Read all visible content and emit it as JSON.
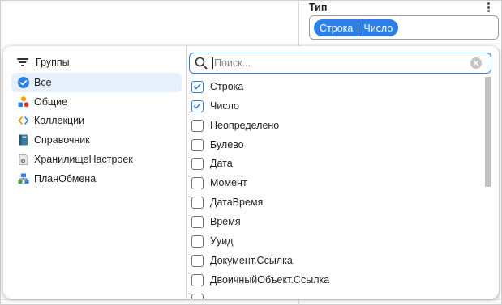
{
  "type_section": {
    "title": "Тип",
    "selected_chips": [
      "Строка",
      "Число"
    ]
  },
  "groups": {
    "header": "Группы",
    "items": [
      {
        "label": "Все",
        "icon": "check-circle-icon",
        "selected": true
      },
      {
        "label": "Общие",
        "icon": "shapes-icon",
        "selected": false
      },
      {
        "label": "Коллекции",
        "icon": "code-brackets-icon",
        "selected": false
      },
      {
        "label": "Справочник",
        "icon": "book-icon",
        "selected": false
      },
      {
        "label": "ХранилищеНастроек",
        "icon": "settings-storage-icon",
        "selected": false
      },
      {
        "label": "ПланОбмена",
        "icon": "exchange-plan-icon",
        "selected": false
      }
    ]
  },
  "search": {
    "placeholder": "Поиск...",
    "value": ""
  },
  "types": [
    {
      "label": "Строка",
      "checked": true
    },
    {
      "label": "Число",
      "checked": true
    },
    {
      "label": "Неопределено",
      "checked": false
    },
    {
      "label": "Булево",
      "checked": false
    },
    {
      "label": "Дата",
      "checked": false
    },
    {
      "label": "Момент",
      "checked": false
    },
    {
      "label": "ДатаВремя",
      "checked": false
    },
    {
      "label": "Время",
      "checked": false
    },
    {
      "label": "Ууид",
      "checked": false
    },
    {
      "label": "Документ.Ссылка",
      "checked": false
    },
    {
      "label": "ДвоичныйОбъект.Ссылка",
      "checked": false
    }
  ],
  "scrollbar": {
    "position_fraction": 0.0,
    "visible_fraction": 0.5
  },
  "colors": {
    "accent": "#2d7fe8",
    "selected_group_bg": "#e6f0fc"
  }
}
